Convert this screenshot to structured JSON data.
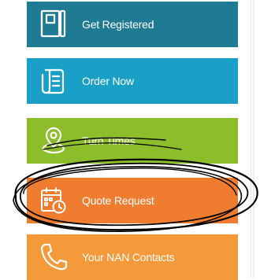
{
  "menu": {
    "items": [
      {
        "label": "Get Registered",
        "icon": "notebook-icon",
        "color": "#1f7a93"
      },
      {
        "label": "Order Now",
        "icon": "document-list-icon",
        "color": "#1aa0c6"
      },
      {
        "label": "Turn Times",
        "icon": "map-pin-route-icon",
        "color": "#8cbd2a"
      },
      {
        "label": "Quote Request",
        "icon": "calendar-clock-icon",
        "color": "#f07d2f"
      },
      {
        "label": "Your NAN Contacts",
        "icon": "phone-icon",
        "color": "#f59a3a"
      }
    ]
  },
  "annotation": {
    "type": "hand-drawn-circle",
    "target": "Quote Request",
    "color": "#000000"
  }
}
